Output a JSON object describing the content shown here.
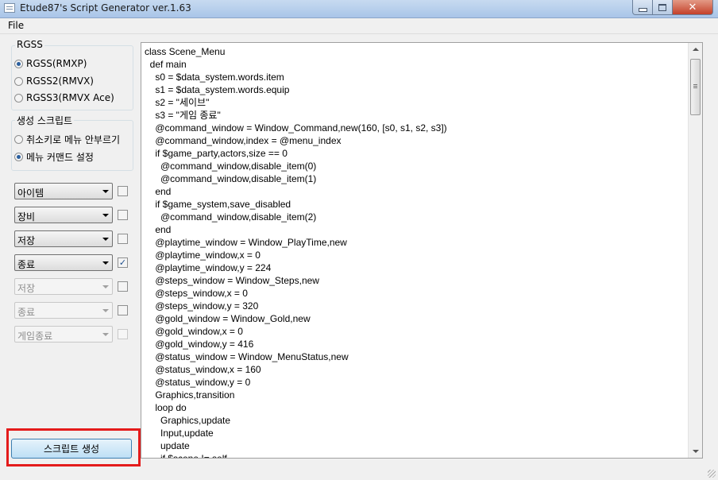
{
  "window": {
    "title": "Etude87's Script Generator ver.1.63",
    "close_glyph": "✕"
  },
  "menu": {
    "file_label": "File"
  },
  "rgss": {
    "label": "RGSS",
    "options": [
      {
        "label": "RGSS(RMXP)",
        "checked": true
      },
      {
        "label": "RGSS2(RMVX)",
        "checked": false
      },
      {
        "label": "RGSS3(RMVX Ace)",
        "checked": false
      }
    ]
  },
  "generate_group": {
    "label": "생성 스크립트",
    "options": [
      {
        "label": "취소키로 메뉴 안부르기",
        "checked": false
      },
      {
        "label": "메뉴 커맨드 설정",
        "checked": true
      }
    ]
  },
  "menu_rows": [
    {
      "value": "아이템",
      "enabled": true,
      "checked": false
    },
    {
      "value": "장비",
      "enabled": true,
      "checked": false
    },
    {
      "value": "저장",
      "enabled": true,
      "checked": false
    },
    {
      "value": "종료",
      "enabled": true,
      "checked": true
    },
    {
      "value": "저장",
      "enabled": false,
      "checked": false
    },
    {
      "value": "종료",
      "enabled": false,
      "checked": false
    },
    {
      "value": "게임종료",
      "enabled": false,
      "checked": false
    }
  ],
  "check_glyph": "✓",
  "generate_button": {
    "label": "스크립트 생성"
  },
  "code_text": "class Scene_Menu\n  def main\n    s0 = $data_system.words.item\n    s1 = $data_system.words.equip\n    s2 = \"세이브\"\n    s3 = \"게임 종료\"\n    @command_window = Window_Command,new(160, [s0, s1, s2, s3])\n    @command_window,index = @menu_index\n    if $game_party,actors,size == 0\n      @command_window,disable_item(0)\n      @command_window,disable_item(1)\n    end\n    if $game_system,save_disabled\n      @command_window,disable_item(2)\n    end\n    @playtime_window = Window_PlayTime,new\n    @playtime_window,x = 0\n    @playtime_window,y = 224\n    @steps_window = Window_Steps,new\n    @steps_window,x = 0\n    @steps_window,y = 320\n    @gold_window = Window_Gold,new\n    @gold_window,x = 0\n    @gold_window,y = 416\n    @status_window = Window_MenuStatus,new\n    @status_window,x = 160\n    @status_window,y = 0\n    Graphics,transition\n    loop do\n      Graphics,update\n      Input,update\n      update\n      if $scene != self"
}
